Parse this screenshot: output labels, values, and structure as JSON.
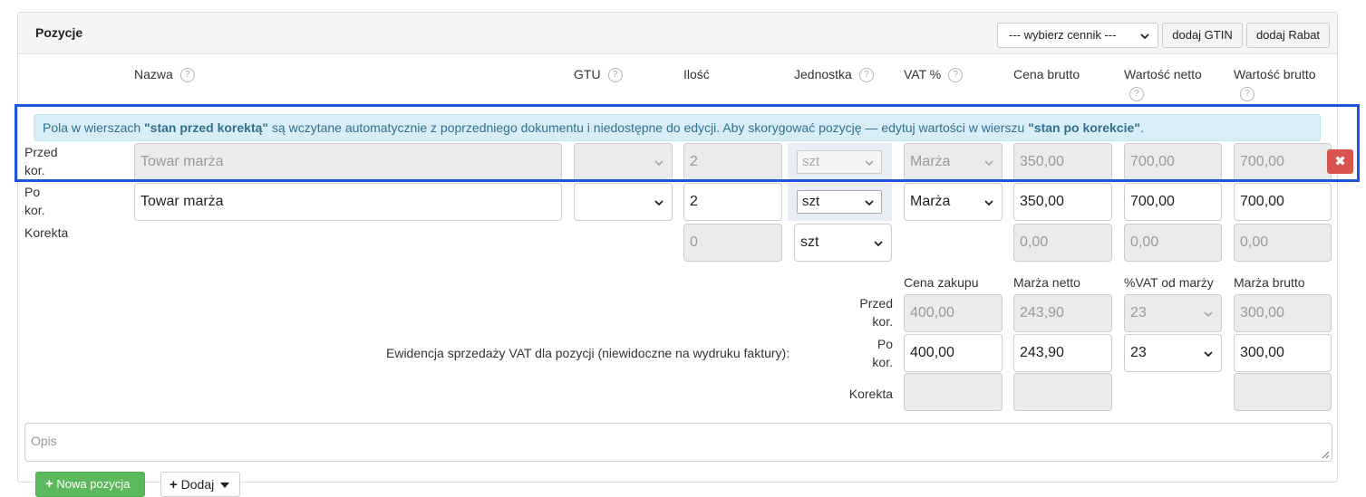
{
  "panel": {
    "title": "Pozycje",
    "pricelist_select": "--- wybierz cennik ---",
    "add_gtin": "dodaj GTIN",
    "add_discount": "dodaj Rabat"
  },
  "columns": {
    "name": "Nazwa",
    "gtu": "GTU",
    "qty": "Ilość",
    "unit": "Jednostka",
    "vat": "VAT %",
    "gross_price": "Cena brutto",
    "net_value": "Wartość netto",
    "gross_value": "Wartość brutto",
    "help": "?"
  },
  "alert": {
    "t1": "Pola w wierszach ",
    "b1": "\"stan przed korektą\"",
    "t2": " są wczytane automatycznie z poprzedniego dokumentu i niedostępne do edycji. Aby skorygować pozycję — edytuj wartości w wierszu ",
    "b2": "\"stan po korekcie\"",
    "t3": "."
  },
  "rows": {
    "before": {
      "label1": "Przed",
      "label2": "kor.",
      "name": "Towar marża",
      "qty": "2",
      "unit": "szt",
      "vat": "Marża",
      "gross_price": "350,00",
      "net_value": "700,00",
      "gross_value": "700,00",
      "delete": "✖"
    },
    "after": {
      "label1": "Po",
      "label2": "kor.",
      "name": "Towar marża",
      "qty": "2",
      "unit": "szt",
      "vat": "Marża",
      "gross_price": "350,00",
      "net_value": "700,00",
      "gross_value": "700,00"
    },
    "correction": {
      "label": "Korekta",
      "qty": "0",
      "unit": "szt",
      "gross_price": "0,00",
      "net_value": "0,00",
      "gross_value": "0,00"
    }
  },
  "margin": {
    "h_purchase": "Cena zakupu",
    "h_net": "Marża netto",
    "h_vat": "%VAT od marży",
    "h_gross": "Marża brutto",
    "description": "Ewidencja sprzedaży VAT dla pozycji (niewidoczne na wydruku faktury):",
    "before": {
      "label1": "Przed",
      "label2": "kor.",
      "purchase": "400,00",
      "net": "243,90",
      "vat": "23",
      "gross": "300,00"
    },
    "after": {
      "label1": "Po",
      "label2": "kor.",
      "purchase": "400,00",
      "net": "243,90",
      "vat": "23",
      "gross": "300,00"
    },
    "correction_label": "Korekta"
  },
  "opis": {
    "placeholder": "Opis"
  },
  "footer": {
    "new_position": "Nowa pozycja",
    "add": "Dodaj"
  }
}
